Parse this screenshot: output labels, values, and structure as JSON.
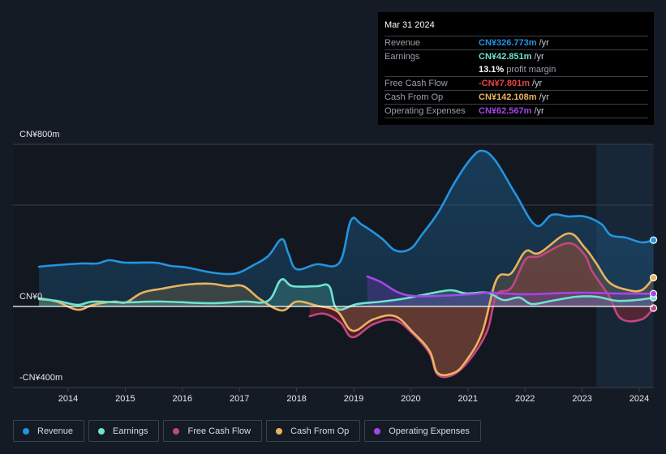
{
  "tooltip": {
    "date": "Mar 31 2024",
    "rows": [
      {
        "label": "Revenue",
        "value": "CN¥326.773m",
        "unit": "/yr",
        "color": "#2394df"
      },
      {
        "label": "Earnings",
        "value": "CN¥42.851m",
        "unit": "/yr",
        "color": "#6ee3cf"
      },
      {
        "label": "",
        "value": "13.1%",
        "unit": "profit margin",
        "color": "#ffffff"
      },
      {
        "label": "Free Cash Flow",
        "value": "-CN¥7.801m",
        "unit": "/yr",
        "color": "#e84545"
      },
      {
        "label": "Cash From Op",
        "value": "CN¥142.108m",
        "unit": "/yr",
        "color": "#e9b35f"
      },
      {
        "label": "Operating Expenses",
        "value": "CN¥62.567m",
        "unit": "/yr",
        "color": "#a546e8"
      }
    ]
  },
  "legend": [
    {
      "label": "Revenue",
      "color": "#2394df"
    },
    {
      "label": "Earnings",
      "color": "#6ee3cf"
    },
    {
      "label": "Free Cash Flow",
      "color": "#c3467f"
    },
    {
      "label": "Cash From Op",
      "color": "#e9b35f"
    },
    {
      "label": "Operating Expenses",
      "color": "#a546e8"
    }
  ],
  "chart_data": {
    "type": "area",
    "title": "",
    "xlabel": "",
    "ylabel": "",
    "unit": "CN¥m",
    "ylim": [
      -400,
      800
    ],
    "xlim": [
      2013.5,
      2024.25
    ],
    "y_tick_labels": [
      {
        "value": 800,
        "label": "CN¥800m"
      },
      {
        "value": 0,
        "label": "CN¥0"
      },
      {
        "value": -400,
        "label": "-CN¥400m"
      }
    ],
    "gridlines": [
      800,
      500,
      0,
      -400
    ],
    "x_ticks": [
      2014,
      2015,
      2016,
      2017,
      2018,
      2019,
      2020,
      2021,
      2022,
      2023,
      2024
    ],
    "highlight_region": [
      2023.25,
      2024.25
    ],
    "grid": true,
    "legend_position": "bottom-left",
    "series": [
      {
        "name": "Revenue",
        "color": "#2394df",
        "x": [
          2013.49,
          2013.8,
          2014.23,
          2014.51,
          2014.72,
          2015.01,
          2015.51,
          2015.8,
          2016.08,
          2016.5,
          2016.79,
          2017.0,
          2017.22,
          2017.5,
          2017.74,
          2017.86,
          2018.0,
          2018.35,
          2018.75,
          2018.95,
          2019.14,
          2019.49,
          2019.73,
          2019.99,
          2020.2,
          2020.48,
          2020.77,
          2021.05,
          2021.25,
          2021.48,
          2021.84,
          2022.19,
          2022.47,
          2022.76,
          2023.04,
          2023.33,
          2023.5,
          2023.76,
          2024.04,
          2024.25
        ],
        "values": [
          196,
          204,
          212,
          212,
          228,
          216,
          216,
          200,
          192,
          168,
          160,
          168,
          200,
          248,
          332,
          260,
          184,
          208,
          216,
          424,
          404,
          336,
          276,
          284,
          356,
          464,
          612,
          728,
          768,
          720,
          552,
          400,
          452,
          444,
          444,
          408,
          352,
          340,
          316,
          327
        ]
      },
      {
        "name": "Earnings",
        "color": "#6ee3cf",
        "x": [
          2013.49,
          2013.8,
          2014.16,
          2014.44,
          2014.94,
          2015.65,
          2016.5,
          2017.07,
          2017.5,
          2017.73,
          2017.93,
          2018.35,
          2018.57,
          2018.71,
          2019.06,
          2019.49,
          2019.91,
          2020.34,
          2020.7,
          2020.98,
          2021.34,
          2021.62,
          2021.9,
          2022.12,
          2022.47,
          2022.9,
          2023.25,
          2023.61,
          2023.96,
          2024.25
        ],
        "values": [
          36,
          28,
          8,
          24,
          20,
          24,
          16,
          24,
          28,
          132,
          100,
          100,
          100,
          -12,
          12,
          24,
          40,
          64,
          80,
          64,
          68,
          32,
          44,
          12,
          28,
          48,
          48,
          28,
          32,
          43
        ]
      },
      {
        "name": "Free Cash Flow",
        "color": "#c3467f",
        "x": [
          2018.23,
          2018.49,
          2018.77,
          2018.98,
          2019.34,
          2019.72,
          2020.04,
          2020.33,
          2020.47,
          2020.75,
          2021.05,
          2021.34,
          2021.5,
          2021.76,
          2022.01,
          2022.25,
          2022.75,
          2023.04,
          2023.18,
          2023.47,
          2023.68,
          2024.04,
          2024.25
        ],
        "values": [
          -48,
          -36,
          -80,
          -152,
          -88,
          -68,
          -136,
          -232,
          -336,
          -336,
          -256,
          -120,
          56,
          92,
          232,
          248,
          312,
          256,
          172,
          52,
          -60,
          -64,
          -8
        ]
      },
      {
        "name": "Cash From Op",
        "color": "#e9b35f",
        "x": [
          2013.49,
          2013.8,
          2014.16,
          2014.44,
          2014.8,
          2015.01,
          2015.3,
          2015.65,
          2016.08,
          2016.5,
          2016.79,
          2017.07,
          2017.36,
          2017.74,
          2018.0,
          2018.35,
          2018.71,
          2018.98,
          2019.34,
          2019.72,
          2020.04,
          2020.33,
          2020.47,
          2020.75,
          2020.96,
          2021.25,
          2021.5,
          2021.76,
          2022.01,
          2022.25,
          2022.75,
          2023.04,
          2023.25,
          2023.47,
          2023.76,
          2024.04,
          2024.25
        ],
        "values": [
          40,
          24,
          -16,
          8,
          24,
          20,
          68,
          88,
          108,
          112,
          100,
          100,
          36,
          -20,
          24,
          4,
          -24,
          -120,
          -64,
          -48,
          -128,
          -220,
          -328,
          -328,
          -272,
          -128,
          132,
          164,
          272,
          264,
          360,
          292,
          212,
          120,
          84,
          80,
          142
        ]
      },
      {
        "name": "Operating Expenses",
        "color": "#a546e8",
        "x": [
          2019.24,
          2019.48,
          2019.76,
          2020.04,
          2020.47,
          2021.05,
          2021.34,
          2021.62,
          2022.05,
          2022.47,
          2023.04,
          2023.61,
          2024.25
        ],
        "values": [
          148,
          120,
          72,
          52,
          52,
          60,
          68,
          64,
          60,
          64,
          68,
          64,
          63
        ]
      }
    ]
  }
}
